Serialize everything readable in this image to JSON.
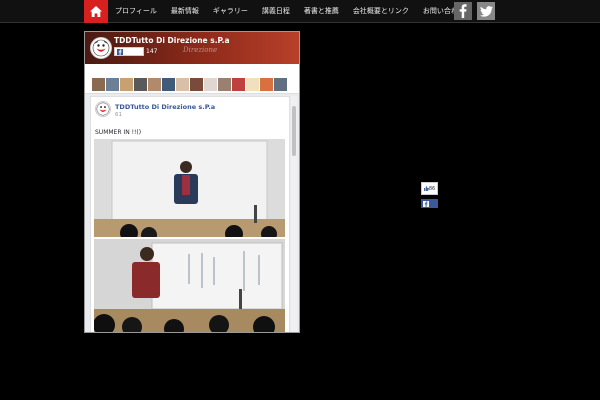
{
  "nav": {
    "items": [
      "プロフィール",
      "最新情報",
      "ギャラリー",
      "講義日程",
      "著書と推薦",
      "会社概要とリンク",
      "お問い合わせ"
    ]
  },
  "colors": {
    "accent": "#d8201e",
    "fb_blue": "#3b5998",
    "link": "#365899"
  },
  "fb_widget": {
    "page_name": "TDDTutto Di Direzione s.P.a",
    "like_count": "147",
    "cover_script": "Direzione",
    "post": {
      "author": "TDDTutto Di Direzione s.P.a",
      "date": "61",
      "text": "SUMMER IN !!()"
    }
  },
  "share": {
    "like_count": "86"
  },
  "icons": {
    "home": "home-icon",
    "facebook": "facebook-icon",
    "twitter": "twitter-icon",
    "like": "thumbs-up-icon"
  }
}
